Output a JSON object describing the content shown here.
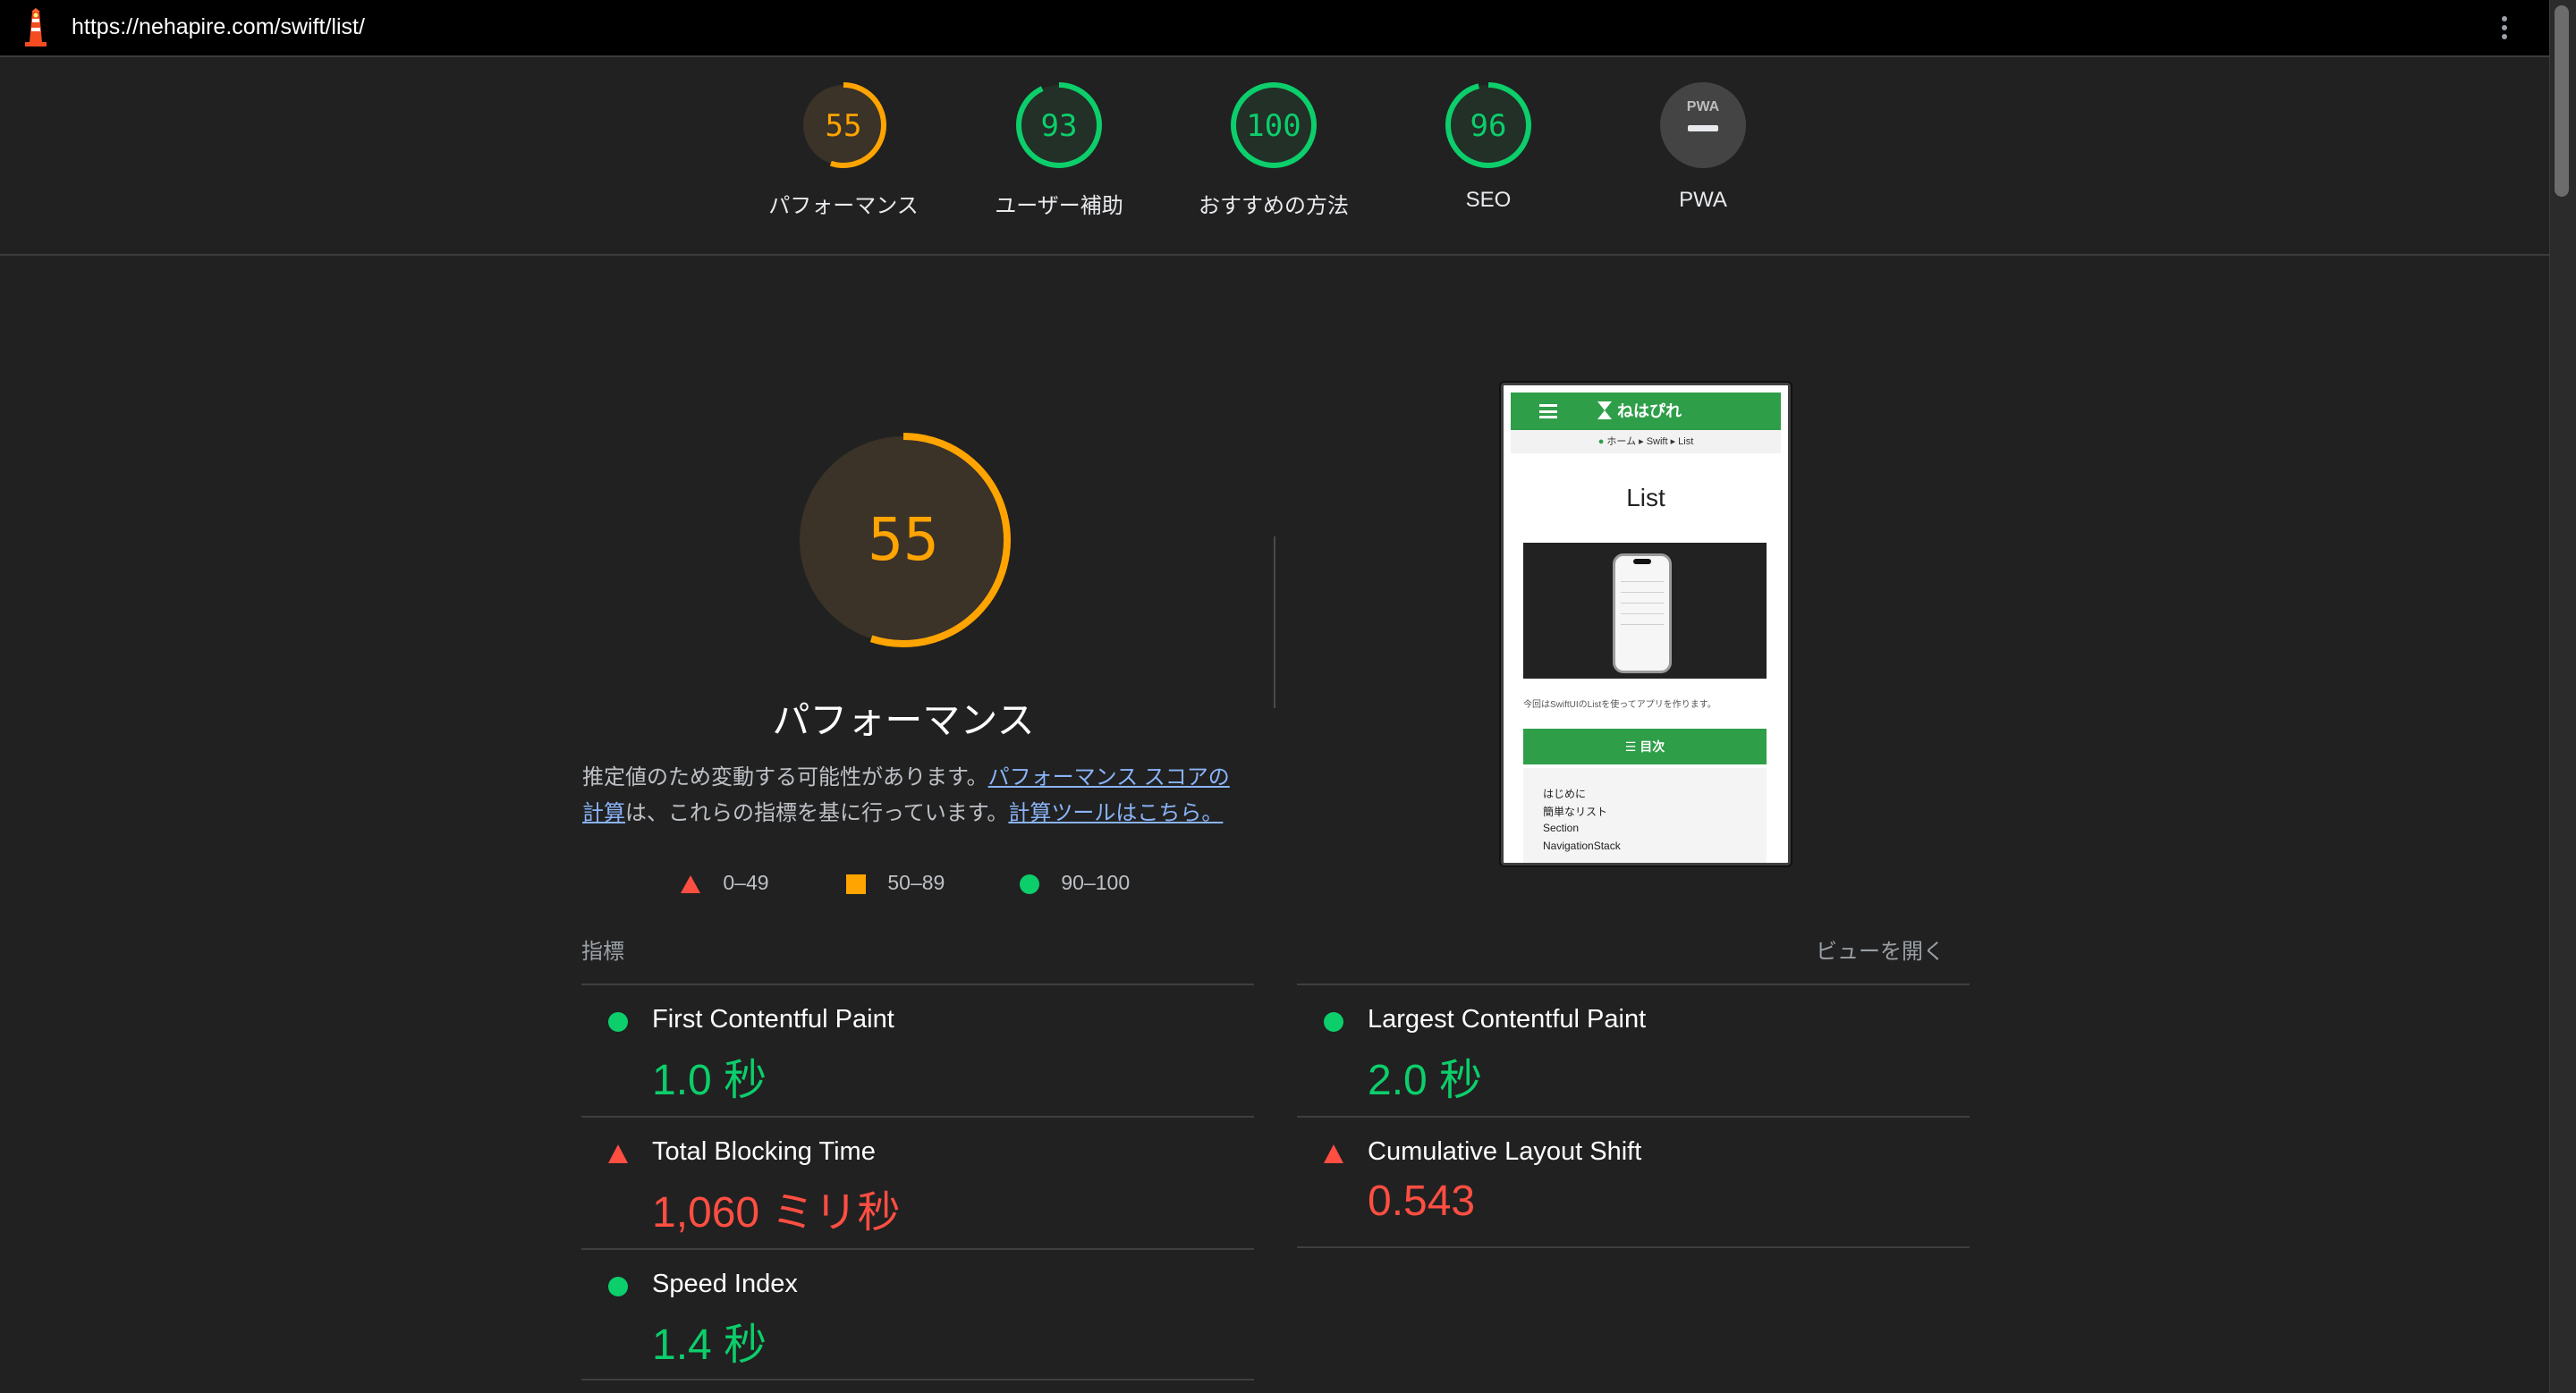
{
  "topbar": {
    "url": "https://nehapire.com/swift/list/"
  },
  "gauges": [
    {
      "score": "55",
      "label": "パフォーマンス",
      "fraction": 0.55,
      "status": "average"
    },
    {
      "score": "93",
      "label": "ユーザー補助",
      "fraction": 0.93,
      "status": "pass"
    },
    {
      "score": "100",
      "label": "おすすめの方法",
      "fraction": 1.0,
      "status": "pass"
    },
    {
      "score": "96",
      "label": "SEO",
      "fraction": 0.96,
      "status": "pass"
    },
    {
      "score": "",
      "label": "PWA",
      "fraction": 0,
      "status": "pwa"
    }
  ],
  "pwa_badge_text": "PWA",
  "performance": {
    "score": "55",
    "fraction": 0.55,
    "title": "パフォーマンス",
    "desc_1": "推定値のため変動する可能性があります。",
    "link_1": "パフォーマンス スコアの計算",
    "desc_2": "は、これらの指標を基に行っています。",
    "link_2": "計算ツールはこちら。"
  },
  "legend": {
    "fail": "0–49",
    "average": "50–89",
    "pass": "90–100"
  },
  "screenshot": {
    "brand": "ねはぴれ",
    "breadcrumb": "ホーム ▸ Swift ▸ List",
    "title": "List",
    "intro": "今回はSwiftUIのListを使ってアプリを作ります。",
    "toc_label": "目次",
    "toc_items": [
      "はじめに",
      "簡単なリスト",
      "Section",
      "NavigationStack"
    ]
  },
  "metrics_header": {
    "label": "指標",
    "toggle": "ビューを開く"
  },
  "metrics": [
    {
      "name": "First Contentful Paint",
      "value": "1.0 秒",
      "status": "pass"
    },
    {
      "name": "Largest Contentful Paint",
      "value": "2.0 秒",
      "status": "pass"
    },
    {
      "name": "Total Blocking Time",
      "value": "1,060 ミリ秒",
      "status": "fail"
    },
    {
      "name": "Cumulative Layout Shift",
      "value": "0.543",
      "status": "fail"
    },
    {
      "name": "Speed Index",
      "value": "1.4 秒",
      "status": "pass"
    }
  ],
  "colors": {
    "pass": "#0cce6b",
    "average": "#ffa400",
    "fail": "#ff4e42",
    "link": "#8ab4f8",
    "background": "#212121"
  }
}
